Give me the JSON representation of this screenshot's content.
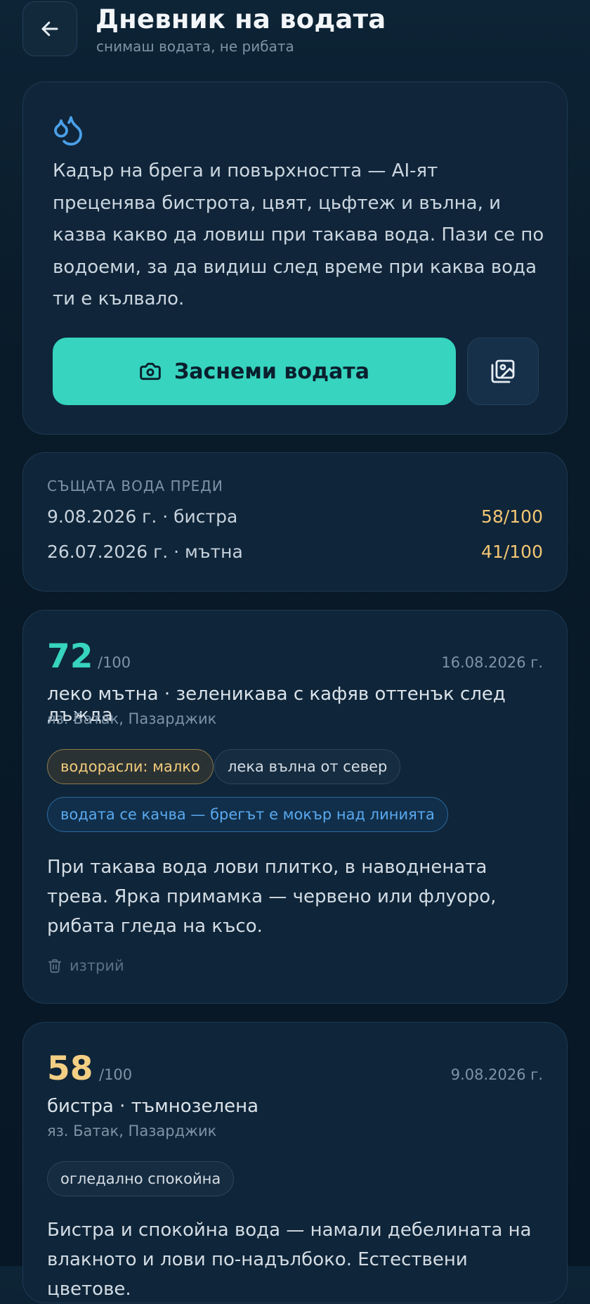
{
  "header": {
    "title": "Дневник на водата",
    "subtitle": "снимаш водата, не рибата"
  },
  "intro": {
    "text": "Кадър на брега и повърхността — AI-ят преценява бистрота, цвят, цьфтеж и вълна, и казва какво да ловиш при такава вода. Пази се по водоеми, за да видиш след време при каква вода ти е кълвало.",
    "capture_label": "Заснеми водата"
  },
  "previous": {
    "heading": "СЪЩАТА ВОДА ПРЕДИ",
    "rows": [
      {
        "label": "9.08.2026 г. · бистра",
        "score": "58/100"
      },
      {
        "label": "26.07.2026 г. · мътна",
        "score": "41/100"
      }
    ]
  },
  "records": [
    {
      "score": "72",
      "out_of": "/100",
      "date": "16.08.2026 г.",
      "description": "леко мътна · зеленикава с кафяв оттенък след дъжда",
      "location": "яз. Батак, Пазарджик",
      "chips": [
        "водорасли: малко",
        "лека вълна от север",
        "водата се качва — брегът е мокър над линията"
      ],
      "advice": "При такава вода лови плитко, в наводнената трева. Ярка примамка — червено или флуоро, рибата гледа на късо.",
      "delete_label": "изтрий",
      "score_color": "#37d4bf"
    },
    {
      "score": "58",
      "out_of": "/100",
      "date": "9.08.2026 г.",
      "description": "бистра · тъмнозелена",
      "location": "яз. Батак, Пазарджик",
      "chips": [
        "огледално спокойна"
      ],
      "advice": "Бистра и спокойна вода — намали дебелината на влакното и лови по-надълбоко. Естествени цветове.",
      "score_color": "#f3cf84"
    }
  ],
  "colors": {
    "accent": "#37d4bf",
    "score_warn": "#f3c674",
    "info": "#5aa9f0"
  }
}
